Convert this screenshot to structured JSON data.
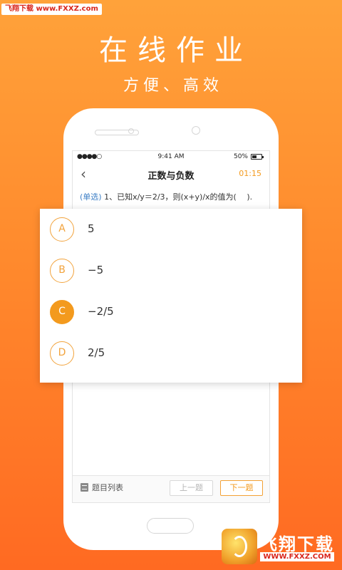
{
  "watermark_top": "飞翔下载 www.FXXZ.com",
  "headline": "在线作业",
  "subheadline": "方便、高效",
  "status_bar": {
    "signal": "●●●●○",
    "time": "9:41 AM",
    "battery": "50%"
  },
  "nav": {
    "back_icon": "‹",
    "title": "正数与负数",
    "timer": "01:15"
  },
  "question": {
    "type": "(单选)",
    "text": " 1、已知x/y＝2/3，则(x+y)/x的值为(　 )."
  },
  "options": [
    {
      "letter": "A",
      "text": "5",
      "selected": false
    },
    {
      "letter": "B",
      "text": "−5",
      "selected": false
    },
    {
      "letter": "C",
      "text": "−2/5",
      "selected": true
    },
    {
      "letter": "D",
      "text": "2/5",
      "selected": false
    }
  ],
  "toolbar": {
    "list_label": "题目列表",
    "prev_label": "上一题",
    "next_label": "下一题"
  },
  "watermark_bottom": {
    "name": "飞翔下载",
    "url": "WWW.FXXZ.COM"
  },
  "colors": {
    "accent": "#f39a1e",
    "background_top": "#ffa23a",
    "background_bottom": "#ff6a22",
    "question_type": "#3d7fc6"
  }
}
